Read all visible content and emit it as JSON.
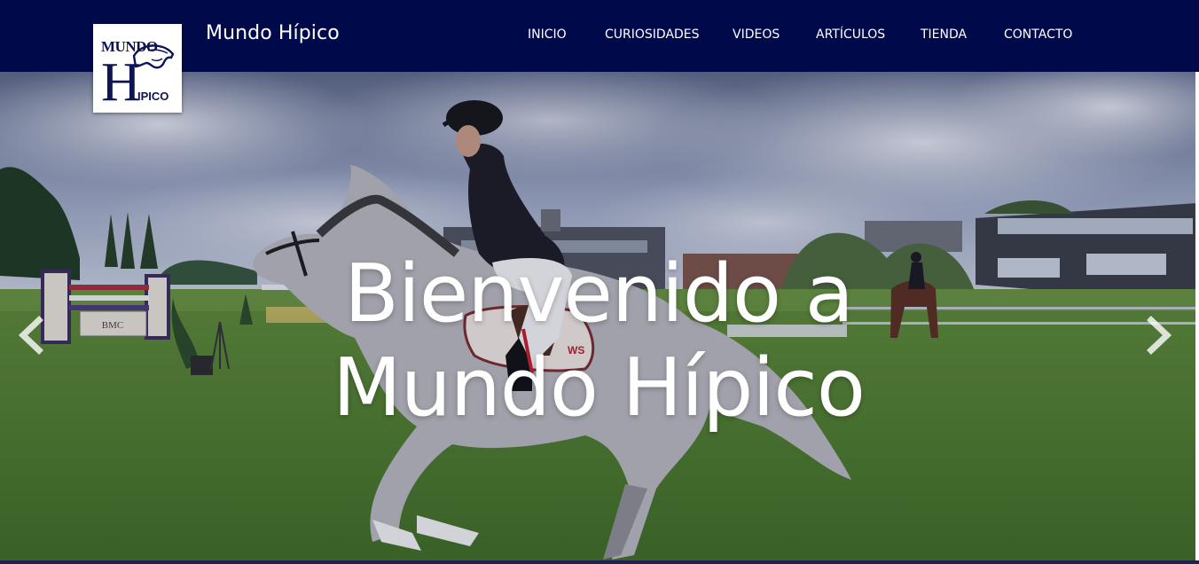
{
  "header": {
    "logo": {
      "line1": "MUNDO",
      "line2": "H",
      "line3": "IPICO"
    },
    "brand": "Mundo Hípico",
    "nav": [
      {
        "label": "INICIO"
      },
      {
        "label": "CURIOSIDADES"
      },
      {
        "label": "VIDEOS"
      },
      {
        "label": "ARTÍCULOS"
      },
      {
        "label": "TIENDA"
      },
      {
        "label": "CONTACTO"
      }
    ]
  },
  "hero": {
    "title_line1": "Bienvenido a",
    "title_line2": "Mundo Hípico",
    "sign_text": "BMC",
    "saddle_pad_text": "WS",
    "prev_icon": "chevron-left-icon",
    "next_icon": "chevron-right-icon"
  },
  "colors": {
    "navbar": "#000a4a",
    "logo_ink": "#0d1552",
    "text": "#ffffff"
  }
}
